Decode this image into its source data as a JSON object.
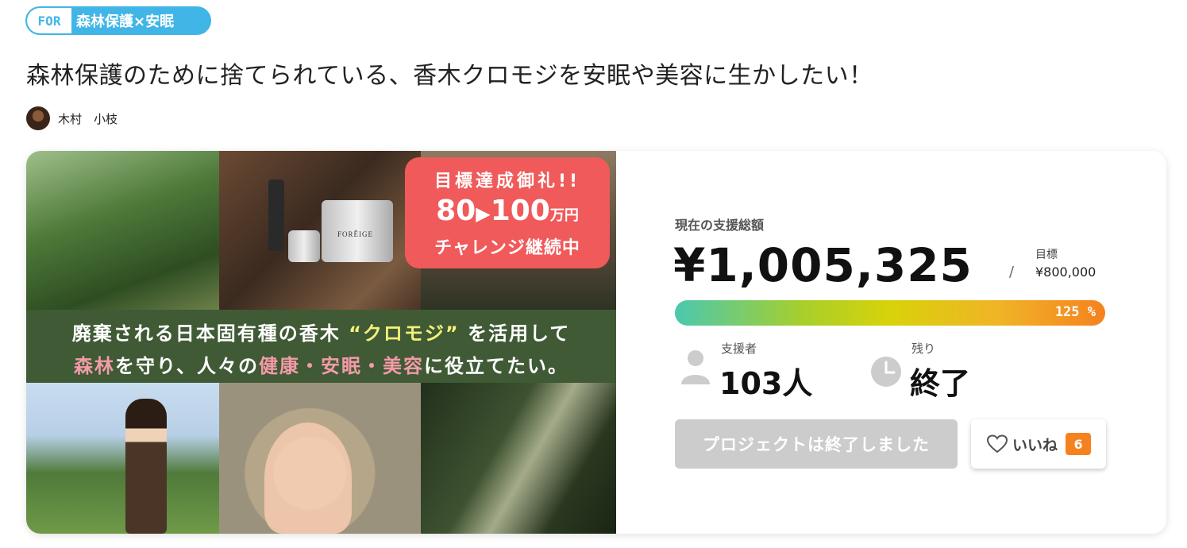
{
  "category_tag": {
    "prefix": "FOR",
    "label": "森林保護×安眠"
  },
  "project": {
    "title": "森林保護のために捨てられている、香木クロモジを安眠や美容に生かしたい！",
    "owner_name": "木村　小枝"
  },
  "hero_image": {
    "badge": {
      "line1": "目標達成御礼!!",
      "from": "80",
      "arrow": "▶",
      "to": "100",
      "unit": "万円",
      "line3": "チャレンジ継続中"
    },
    "banner": {
      "l1_a": "廃棄される日本固有種の香木",
      "l1_b": "“クロモジ”",
      "l1_c": "を活用して",
      "l2_a": "森林",
      "l2_b": "を守り、人々の",
      "l2_c": "健康・安眠・美容",
      "l2_d": "に役立てたい。"
    },
    "product_label": "FORÊIGE"
  },
  "funding": {
    "total_label": "現在の支援総額",
    "total_amount": "¥1,005,325",
    "separator": "/",
    "goal_label": "目標",
    "goal_amount": "¥800,000",
    "progress_percent": 125,
    "progress_text": "125 %"
  },
  "stats": {
    "backers_label": "支援者",
    "backers_value": "103人",
    "remaining_label": "残り",
    "remaining_value": "終了"
  },
  "actions": {
    "ended_button": "プロジェクトは終了しました",
    "like_label": "いいね",
    "like_count": "6"
  },
  "colors": {
    "tag_blue": "#41b6e6",
    "badge_red": "#f05a5a",
    "banner_green": "#3f5a35",
    "like_orange": "#f5821f",
    "disabled_gray": "#cccccc"
  }
}
